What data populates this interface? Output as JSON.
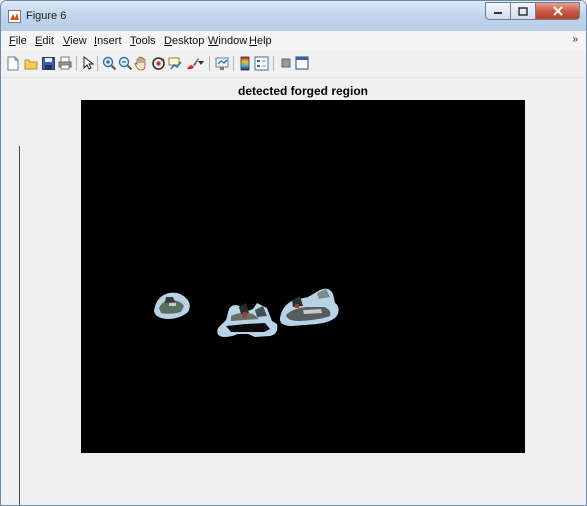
{
  "window": {
    "title": "Figure 6"
  },
  "menu": [
    {
      "key": "F",
      "rest": "ile"
    },
    {
      "key": "E",
      "rest": "dit"
    },
    {
      "key": "V",
      "rest": "iew"
    },
    {
      "key": "I",
      "rest": "nsert"
    },
    {
      "key": "T",
      "rest": "ools"
    },
    {
      "key": "D",
      "rest": "esktop"
    },
    {
      "key": "W",
      "rest": "indow"
    },
    {
      "key": "H",
      "rest": "elp"
    }
  ],
  "toolbar": {
    "icons": [
      "new-figure-icon",
      "open-file-icon",
      "save-icon",
      "print-icon",
      "pointer-icon",
      "zoom-in-icon",
      "zoom-out-icon",
      "pan-icon",
      "rotate-3d-icon",
      "data-cursor-icon",
      "brush-icon",
      "link-plot-icon",
      "colorbar-icon",
      "legend-icon",
      "hide-plot-tools-icon",
      "show-plot-tools-icon"
    ]
  },
  "figure": {
    "title": "detected forged region"
  },
  "colors": {
    "axes_background": "#000000",
    "region_tint": "#b9d3e6"
  }
}
